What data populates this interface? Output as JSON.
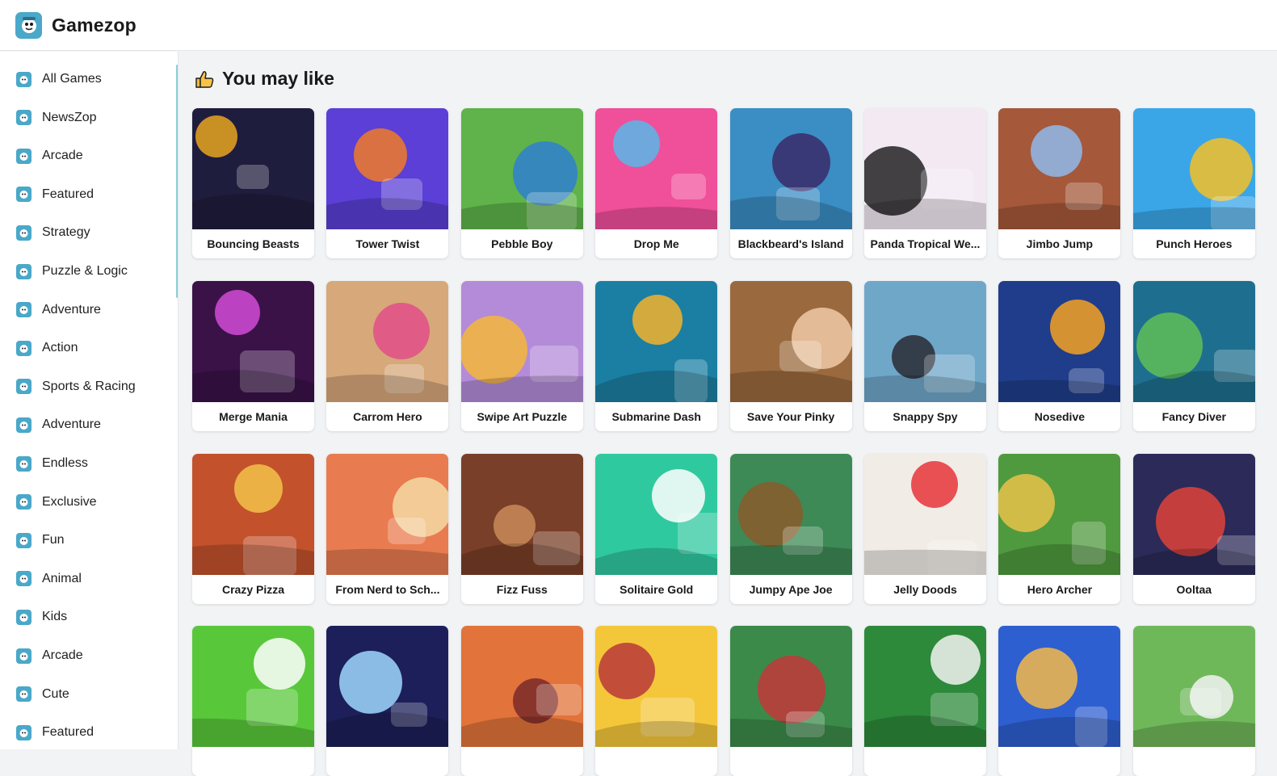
{
  "app": {
    "name": "Gamezop",
    "logo_icon": "gamezop-mascot-icon",
    "accent": "#4aa8c9"
  },
  "sidebar": {
    "items": [
      {
        "label": "All Games",
        "icon": "category-icon"
      },
      {
        "label": "NewsZop",
        "icon": "category-icon"
      },
      {
        "label": "Arcade",
        "icon": "category-icon"
      },
      {
        "label": "Featured",
        "icon": "category-icon"
      },
      {
        "label": "Strategy",
        "icon": "category-icon"
      },
      {
        "label": "Puzzle & Logic",
        "icon": "category-icon"
      },
      {
        "label": "Adventure",
        "icon": "category-icon"
      },
      {
        "label": "Action",
        "icon": "category-icon"
      },
      {
        "label": "Sports & Racing",
        "icon": "category-icon"
      },
      {
        "label": "Adventure",
        "icon": "category-icon"
      },
      {
        "label": "Endless",
        "icon": "category-icon"
      },
      {
        "label": "Exclusive",
        "icon": "category-icon"
      },
      {
        "label": "Fun",
        "icon": "category-icon"
      },
      {
        "label": "Animal",
        "icon": "category-icon"
      },
      {
        "label": "Kids",
        "icon": "category-icon"
      },
      {
        "label": "Arcade",
        "icon": "category-icon"
      },
      {
        "label": "Cute",
        "icon": "category-icon"
      },
      {
        "label": "Featured",
        "icon": "category-icon"
      }
    ]
  },
  "main": {
    "section_title": "You may like",
    "section_icon": "thumbs-up-icon",
    "games": [
      {
        "title": "Bouncing Beasts",
        "bg": "#1f1d3d",
        "fg": "#e8a420"
      },
      {
        "title": "Tower Twist",
        "bg": "#5b3fd6",
        "fg": "#f07a28"
      },
      {
        "title": "Pebble Boy",
        "bg": "#5fb34a",
        "fg": "#2f7fd0"
      },
      {
        "title": "Drop Me",
        "bg": "#f04f9a",
        "fg": "#57b7e8"
      },
      {
        "title": "Blackbeard's Island",
        "bg": "#3a8ec4",
        "fg": "#3b2a6a"
      },
      {
        "title": "Panda Tropical We...",
        "bg": "#f3e9f3",
        "fg": "#222222"
      },
      {
        "title": "Jimbo Jump",
        "bg": "#a5583a",
        "fg": "#8fb8ec"
      },
      {
        "title": "Punch Heroes",
        "bg": "#3aa6e8",
        "fg": "#f4c026"
      },
      {
        "title": "Merge Mania",
        "bg": "#3a1248",
        "fg": "#d24bd6"
      },
      {
        "title": "Carrom Hero",
        "bg": "#d7a87a",
        "fg": "#e24f88"
      },
      {
        "title": "Swipe Art Puzzle",
        "bg": "#b48bd8",
        "fg": "#f4b63a"
      },
      {
        "title": "Submarine Dash",
        "bg": "#1b7fa3",
        "fg": "#f2b22c"
      },
      {
        "title": "Save Your Pinky",
        "bg": "#9a6a3e",
        "fg": "#f0c9a6"
      },
      {
        "title": "Snappy Spy",
        "bg": "#6fa7c9",
        "fg": "#2a2a34"
      },
      {
        "title": "Nosedive",
        "bg": "#1f3d8a",
        "fg": "#f4a123"
      },
      {
        "title": "Fancy Diver",
        "bg": "#1e6f8f",
        "fg": "#5fbf58"
      },
      {
        "title": "Crazy Pizza",
        "bg": "#c3522c",
        "fg": "#f3c24a"
      },
      {
        "title": "From Nerd to Sch...",
        "bg": "#e87b4f",
        "fg": "#f4d9a2"
      },
      {
        "title": "Fizz Fuss",
        "bg": "#7a3f28",
        "fg": "#c98b58"
      },
      {
        "title": "Solitaire Gold",
        "bg": "#2fc9a0",
        "fg": "#ffffff"
      },
      {
        "title": "Jumpy Ape Joe",
        "bg": "#3d8a56",
        "fg": "#8a5a2a"
      },
      {
        "title": "Jelly Doods",
        "bg": "#f1ece6",
        "fg": "#e6353a"
      },
      {
        "title": "Hero Archer",
        "bg": "#4f9a3e",
        "fg": "#e8c24a"
      },
      {
        "title": "Ooltaa",
        "bg": "#2b2a58",
        "fg": "#e0423a"
      },
      {
        "title": "",
        "bg": "#58c83a",
        "fg": "#ffffff"
      },
      {
        "title": "",
        "bg": "#1d1f5a",
        "fg": "#9fd8ff"
      },
      {
        "title": "",
        "bg": "#e2733a",
        "fg": "#7a2a2a"
      },
      {
        "title": "",
        "bg": "#f4c73a",
        "fg": "#b8383a"
      },
      {
        "title": "",
        "bg": "#3b8a4a",
        "fg": "#c4373a"
      },
      {
        "title": "",
        "bg": "#2c8a3a",
        "fg": "#f2f2f2"
      },
      {
        "title": "",
        "bg": "#2e5fd0",
        "fg": "#f4b94a"
      },
      {
        "title": "",
        "bg": "#6fb85a",
        "fg": "#f2f2f2"
      }
    ]
  }
}
